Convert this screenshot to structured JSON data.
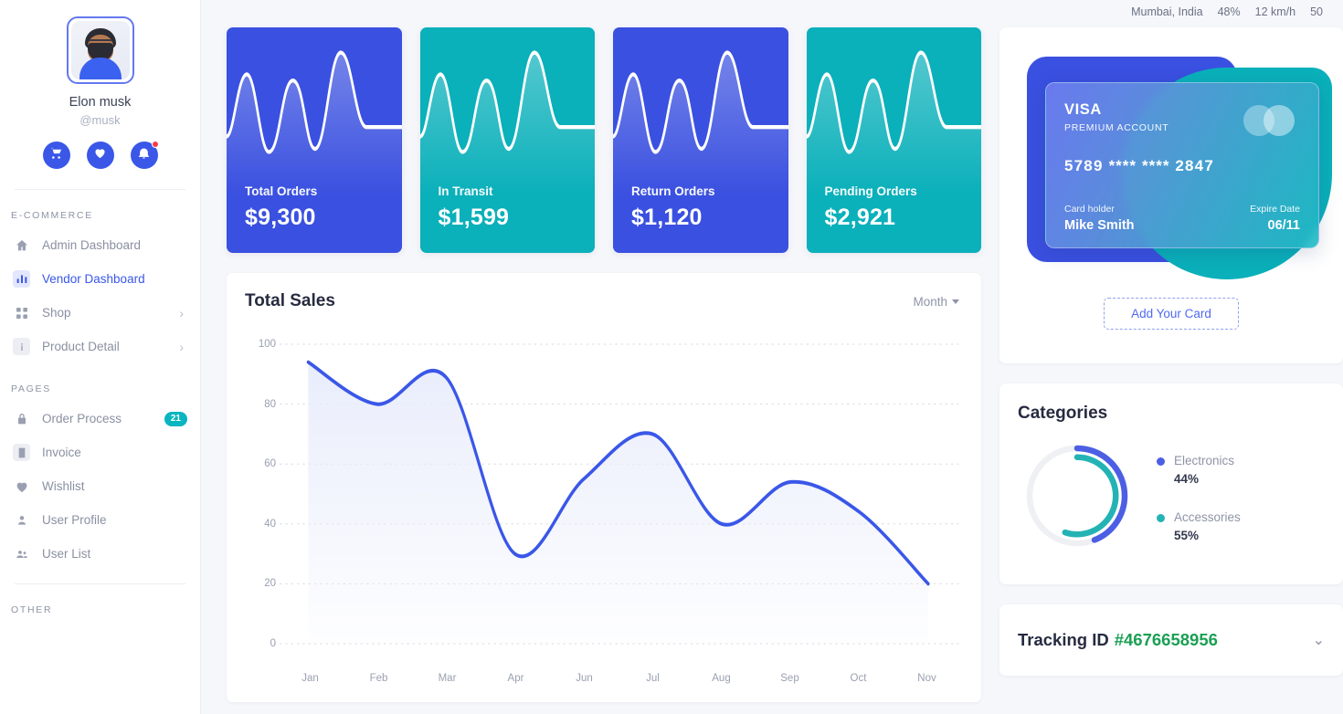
{
  "sidebar": {
    "profile": {
      "name": "Elon musk",
      "handle": "@musk",
      "actions": [
        {
          "icon": "cart-icon",
          "name": "cart-button"
        },
        {
          "icon": "heart-icon",
          "name": "wishlist-button"
        },
        {
          "icon": "bell-icon",
          "name": "notifications-button",
          "badge": true
        }
      ]
    },
    "sections": [
      {
        "title": "E-COMMERCE",
        "items": [
          {
            "label": "Admin Dashboard",
            "icon": "home-icon",
            "active": false,
            "chevron": false,
            "badge": null
          },
          {
            "label": "Vendor Dashboard",
            "icon": "bar-chart-icon",
            "active": true,
            "chevron": false,
            "badge": null
          },
          {
            "label": "Shop",
            "icon": "grid-icon",
            "active": false,
            "chevron": true,
            "badge": null
          },
          {
            "label": "Product Detail",
            "icon": "info-icon",
            "active": false,
            "chevron": true,
            "badge": null
          }
        ]
      },
      {
        "title": "PAGES",
        "items": [
          {
            "label": "Order Process",
            "icon": "lock-icon",
            "active": false,
            "chevron": false,
            "badge": "21"
          },
          {
            "label": "Invoice",
            "icon": "document-icon",
            "active": false,
            "chevron": false,
            "badge": null
          },
          {
            "label": "Wishlist",
            "icon": "heart-icon",
            "active": false,
            "chevron": false,
            "badge": null
          },
          {
            "label": "User Profile",
            "icon": "user-icon",
            "active": false,
            "chevron": false,
            "badge": null
          },
          {
            "label": "User List",
            "icon": "users-icon",
            "active": false,
            "chevron": false,
            "badge": null
          }
        ]
      },
      {
        "title": "OTHER",
        "items": []
      }
    ]
  },
  "header": {
    "weather": {
      "location": "Mumbai, India",
      "humidity": "48%",
      "wind": "12 km/h",
      "temp": "50"
    }
  },
  "stats": [
    {
      "label": "Total Orders",
      "value": "$9,300",
      "color": "#3a50e0",
      "theme": "blue"
    },
    {
      "label": "In Transit",
      "value": "$1,599",
      "color": "#0ab0ba",
      "theme": "teal"
    },
    {
      "label": "Return Orders",
      "value": "$1,120",
      "color": "#3a50e0",
      "theme": "blue"
    },
    {
      "label": "Pending Orders",
      "value": "$2,921",
      "color": "#0ab0ba",
      "theme": "teal"
    }
  ],
  "sales": {
    "title": "Total Sales",
    "range_label": "Month"
  },
  "chart_data": {
    "type": "area",
    "title": "Total Sales",
    "xlabel": "",
    "ylabel": "",
    "ylim": [
      0,
      100
    ],
    "yticks": [
      0,
      20,
      40,
      60,
      80,
      100
    ],
    "ytick_labels": [
      "0",
      "20",
      "40",
      "60",
      "80",
      "100"
    ],
    "grid": true,
    "legend": "none",
    "line_color": "#3a57e8",
    "fill_color": "#e8ecfb",
    "categories": [
      "Jan",
      "Feb",
      "Mar",
      "Apr",
      "Jun",
      "Jul",
      "Aug",
      "Sep",
      "Oct",
      "Nov"
    ],
    "values": [
      94,
      80,
      89,
      30,
      55,
      70,
      40,
      54,
      44,
      20
    ]
  },
  "credit_card": {
    "brand": "VISA",
    "account_type": "PREMIUM ACCOUNT",
    "number_part1": "5789",
    "number_mask1": "****",
    "number_mask2": "****",
    "number_part2": "2847",
    "holder_label": "Card holder",
    "holder_name": "Mike Smith",
    "expire_label": "Expire Date",
    "expire_date": "06/11",
    "add_card_label": "Add Your Card"
  },
  "categories": {
    "title": "Categories",
    "items": [
      {
        "name": "Electronics",
        "percent": "44%",
        "value": 44,
        "color": "#4c5fe4"
      },
      {
        "name": "Accessories",
        "percent": "55%",
        "value": 55,
        "color": "#24b3b5"
      }
    ],
    "chart_data": {
      "type": "pie",
      "title": "Categories",
      "labels": [
        "Electronics",
        "Accessories"
      ],
      "values": [
        44,
        55
      ],
      "colors": [
        "#4c5fe4",
        "#24b3b5"
      ]
    }
  },
  "tracking": {
    "label": "Tracking ID",
    "id": "#4676658956",
    "id_color": "#1aa053"
  }
}
